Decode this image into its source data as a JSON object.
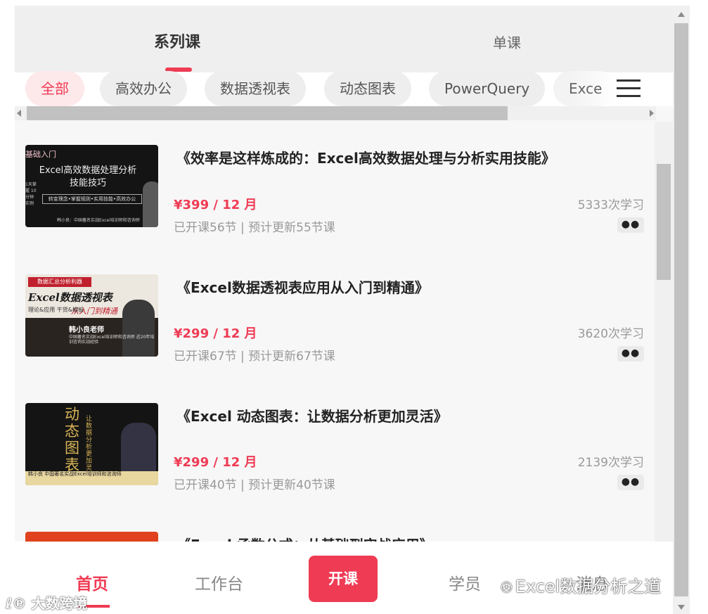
{
  "top_tabs": {
    "series": "系列课",
    "single": "单课"
  },
  "categories": [
    {
      "label": "全部",
      "active": true
    },
    {
      "label": "高效办公"
    },
    {
      "label": "数据透视表"
    },
    {
      "label": "动态图表"
    },
    {
      "label": "PowerQuery"
    },
    {
      "label": "Exce"
    }
  ],
  "courses": [
    {
      "title": "《效率是这样炼成的：Excel高效数据处理与分析实用技能》",
      "price": "¥399 / 12 月",
      "meta": "已开课56节 | 预计更新55节课",
      "count": "5333次学习",
      "more": "●●",
      "thumb": {
        "tag": "基础入门",
        "headline": "Excel高效数据处理分析技能技巧",
        "subline": "转变理念•掌握规则•实用技能•高效办公",
        "sidebar": "1天掌握 10分钟 实例",
        "footer": "韩小良：中国著名实战Excel培训师和咨询师"
      }
    },
    {
      "title": "《Excel数据透视表应用从入门到精通》",
      "price": "¥299 / 12 月",
      "meta": "已开课67节 | 预计更新67节课",
      "count": "3620次学习",
      "more": "●●",
      "thumb": {
        "tag": "数据汇总分析利器",
        "headline": "Excel数据透视表",
        "subline": "从入门到精通",
        "sidebar": "理论&应用 干货&模板",
        "teacher": "韩小良老师",
        "footer": "中国著名实战Excel培训师和咨询师 近20年培训咨询实战经验"
      }
    },
    {
      "title": "《Excel 动态图表：让数据分析更加灵活》",
      "price": "¥299 / 12 月",
      "meta": "已开课40节 | 预计更新40节课",
      "count": "2139次学习",
      "more": "●●",
      "thumb": {
        "headline": "动态图表",
        "subline": "让数据分析更加灵活",
        "footer": "韩小良 中国著名实战Excel培训师和咨询师"
      }
    },
    {
      "title": "《Excel 函数公式：从基础到实战应用》"
    }
  ],
  "tabbar": {
    "home": "首页",
    "work": "工作台",
    "open": "开课",
    "student": "学员",
    "message": "消息"
  },
  "watermarks": {
    "left": "大数跨境",
    "right": "Excel数据分析之道"
  },
  "colors": {
    "accent": "#ef3b54",
    "muted": "#999999"
  },
  "icons": {
    "menu": "hamburger-menu-icon",
    "more": "more-dots-icon",
    "wechat": "wechat-icon"
  }
}
